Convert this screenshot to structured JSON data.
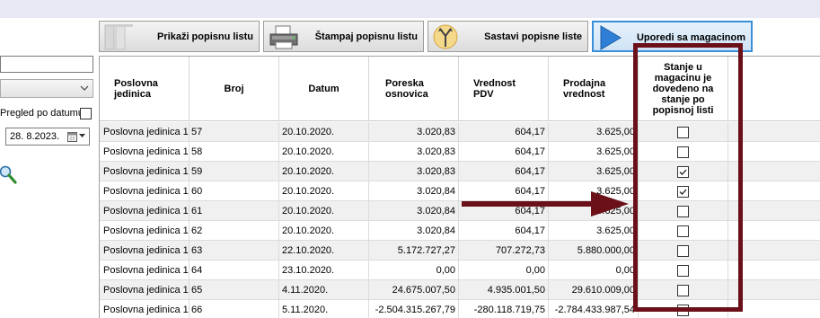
{
  "toolbar": {
    "show_list_label": "Prikaži popisnu listu",
    "print_list_label": "Štampaj popisnu listu",
    "compose_lists_label": "Sastavi popisne liste",
    "compare_warehouse_label": "Uporedi sa magacinom"
  },
  "filters": {
    "search_value": "",
    "combo_value": "",
    "pregled_label": "Pregled po datumu",
    "date_value": "28.  8.2023."
  },
  "grid": {
    "headers": {
      "business_unit": "Poslovna jedinica",
      "number": "Broj",
      "date": "Datum",
      "tax_base": "Poreska osnovica",
      "vat": "Vrednost PDV",
      "sale_value": "Prodajna vrednost",
      "stock_status": "Stanje u magacinu je dovedeno na stanje po popisnoj listi"
    },
    "rows": [
      {
        "unit": "Poslovna jedinica 1",
        "num": "57",
        "date": "20.10.2020.",
        "base": "3.020,83",
        "vat": "604,17",
        "sale": "3.625,00",
        "checked": false
      },
      {
        "unit": "Poslovna jedinica 1",
        "num": "58",
        "date": "20.10.2020.",
        "base": "3.020,83",
        "vat": "604,17",
        "sale": "3.625,00",
        "checked": false
      },
      {
        "unit": "Poslovna jedinica 1",
        "num": "59",
        "date": "20.10.2020.",
        "base": "3.020,83",
        "vat": "604,17",
        "sale": "3.625,00",
        "checked": true
      },
      {
        "unit": "Poslovna jedinica 1",
        "num": "60",
        "date": "20.10.2020.",
        "base": "3.020,84",
        "vat": "604,17",
        "sale": "3.625,00",
        "checked": true
      },
      {
        "unit": "Poslovna jedinica 1",
        "num": "61",
        "date": "20.10.2020.",
        "base": "3.020,84",
        "vat": "604,17",
        "sale": "3.625,00",
        "checked": false
      },
      {
        "unit": "Poslovna jedinica 1",
        "num": "62",
        "date": "20.10.2020.",
        "base": "3.020,84",
        "vat": "604,17",
        "sale": "3.625,00",
        "checked": false
      },
      {
        "unit": "Poslovna jedinica 1",
        "num": "63",
        "date": "22.10.2020.",
        "base": "5.172.727,27",
        "vat": "707.272,73",
        "sale": "5.880.000,00",
        "checked": false
      },
      {
        "unit": "Poslovna jedinica 1",
        "num": "64",
        "date": "23.10.2020.",
        "base": "0,00",
        "vat": "0,00",
        "sale": "0,00",
        "checked": false
      },
      {
        "unit": "Poslovna jedinica 1",
        "num": "65",
        "date": "4.11.2020.",
        "base": "24.675.007,50",
        "vat": "4.935.001,50",
        "sale": "29.610.009,00",
        "checked": false
      },
      {
        "unit": "Poslovna jedinica 1",
        "num": "66",
        "date": "5.11.2020.",
        "base": "-2.504.315.267,79",
        "vat": "-280.118.719,75",
        "sale": "-2.784.433.987,54",
        "checked": false
      }
    ]
  },
  "colors": {
    "annotation": "#6b1018",
    "active_button_border": "#3a8fd8"
  }
}
